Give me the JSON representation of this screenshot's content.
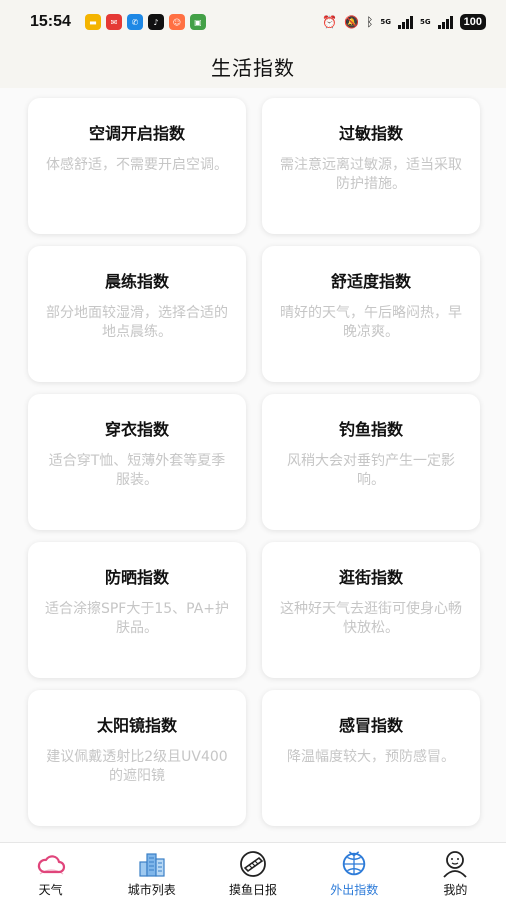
{
  "status_bar": {
    "time": "15:54",
    "battery": "100",
    "network": "5G",
    "icons": [
      "alarm-icon",
      "mute-icon",
      "bluetooth-icon",
      "signal-icon",
      "signal-icon",
      "battery-icon"
    ]
  },
  "header": {
    "title": "生活指数"
  },
  "cards": [
    {
      "title": "空调开启指数",
      "desc": "体感舒适，不需要开启空调。"
    },
    {
      "title": "过敏指数",
      "desc": "需注意远离过敏源，适当采取防护措施。"
    },
    {
      "title": "晨练指数",
      "desc": "部分地面较湿滑，选择合适的地点晨练。"
    },
    {
      "title": "舒适度指数",
      "desc": "晴好的天气，午后略闷热，早晚凉爽。"
    },
    {
      "title": "穿衣指数",
      "desc": "适合穿T恤、短薄外套等夏季服装。"
    },
    {
      "title": "钓鱼指数",
      "desc": "风稍大会对垂钓产生一定影响。"
    },
    {
      "title": "防晒指数",
      "desc": "适合涂擦SPF大于15、PA+护肤品。"
    },
    {
      "title": "逛街指数",
      "desc": "这种好天气去逛街可使身心畅快放松。"
    },
    {
      "title": "太阳镜指数",
      "desc": "建议佩戴透射比2级且UV400的遮阳镜"
    },
    {
      "title": "感冒指数",
      "desc": "降温幅度较大，预防感冒。"
    }
  ],
  "tabs": [
    {
      "label": "天气",
      "icon": "cloud-icon",
      "active": false
    },
    {
      "label": "城市列表",
      "icon": "city-icon",
      "active": false
    },
    {
      "label": "摸鱼日报",
      "icon": "fish-icon",
      "active": false
    },
    {
      "label": "外出指数",
      "icon": "globe-icon",
      "active": true
    },
    {
      "label": "我的",
      "icon": "user-icon",
      "active": false
    }
  ],
  "colors": {
    "accent": "#2d7bd8",
    "cloud": "#e0457b",
    "desc": "#c6c6c6"
  }
}
